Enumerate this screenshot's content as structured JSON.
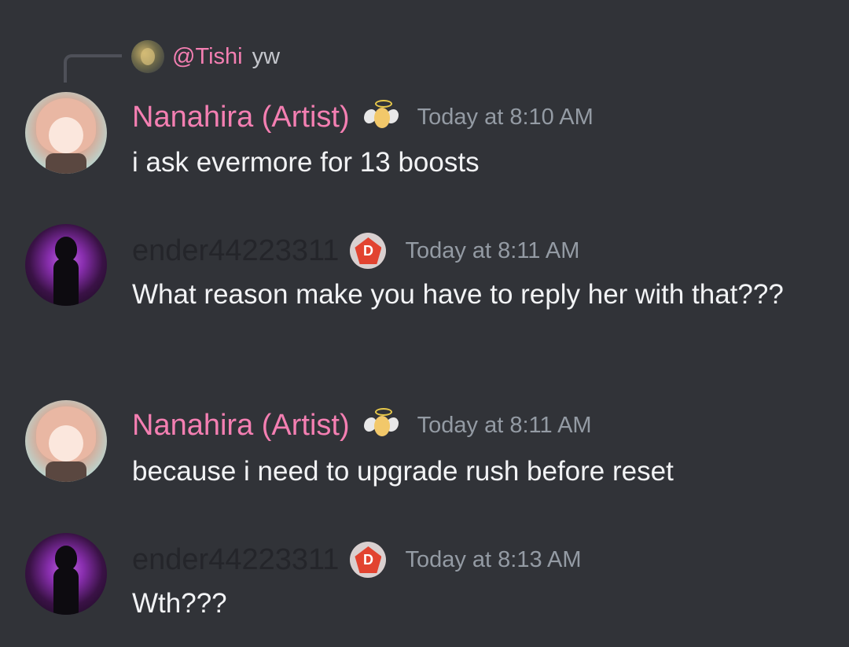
{
  "reply": {
    "mention": "@Tishi",
    "text": "yw"
  },
  "messages": [
    {
      "author": "Nanahira (Artist)",
      "author_color": "#f47fb2",
      "badge": "angel-badge-icon",
      "timestamp": "Today at 8:10 AM",
      "text": "i ask evermore for 13 boosts"
    },
    {
      "author": "ender44223311",
      "author_color": "#24252a",
      "badge": "boost-badge-icon",
      "timestamp": "Today at 8:11 AM",
      "text": "What reason make you have to reply her with that???"
    },
    {
      "author": "Nanahira (Artist)",
      "author_color": "#f47fb2",
      "badge": "angel-badge-icon",
      "timestamp": "Today at 8:11 AM",
      "text": "because i need to upgrade rush before reset"
    },
    {
      "author": "ender44223311",
      "author_color": "#24252a",
      "badge": "boost-badge-icon",
      "timestamp": "Today at 8:13 AM",
      "text": "Wth???"
    }
  ],
  "colors": {
    "background": "#313338",
    "mention": "#f47fb2",
    "timestamp": "#949ba4",
    "message_text": "#f2f3f5"
  }
}
